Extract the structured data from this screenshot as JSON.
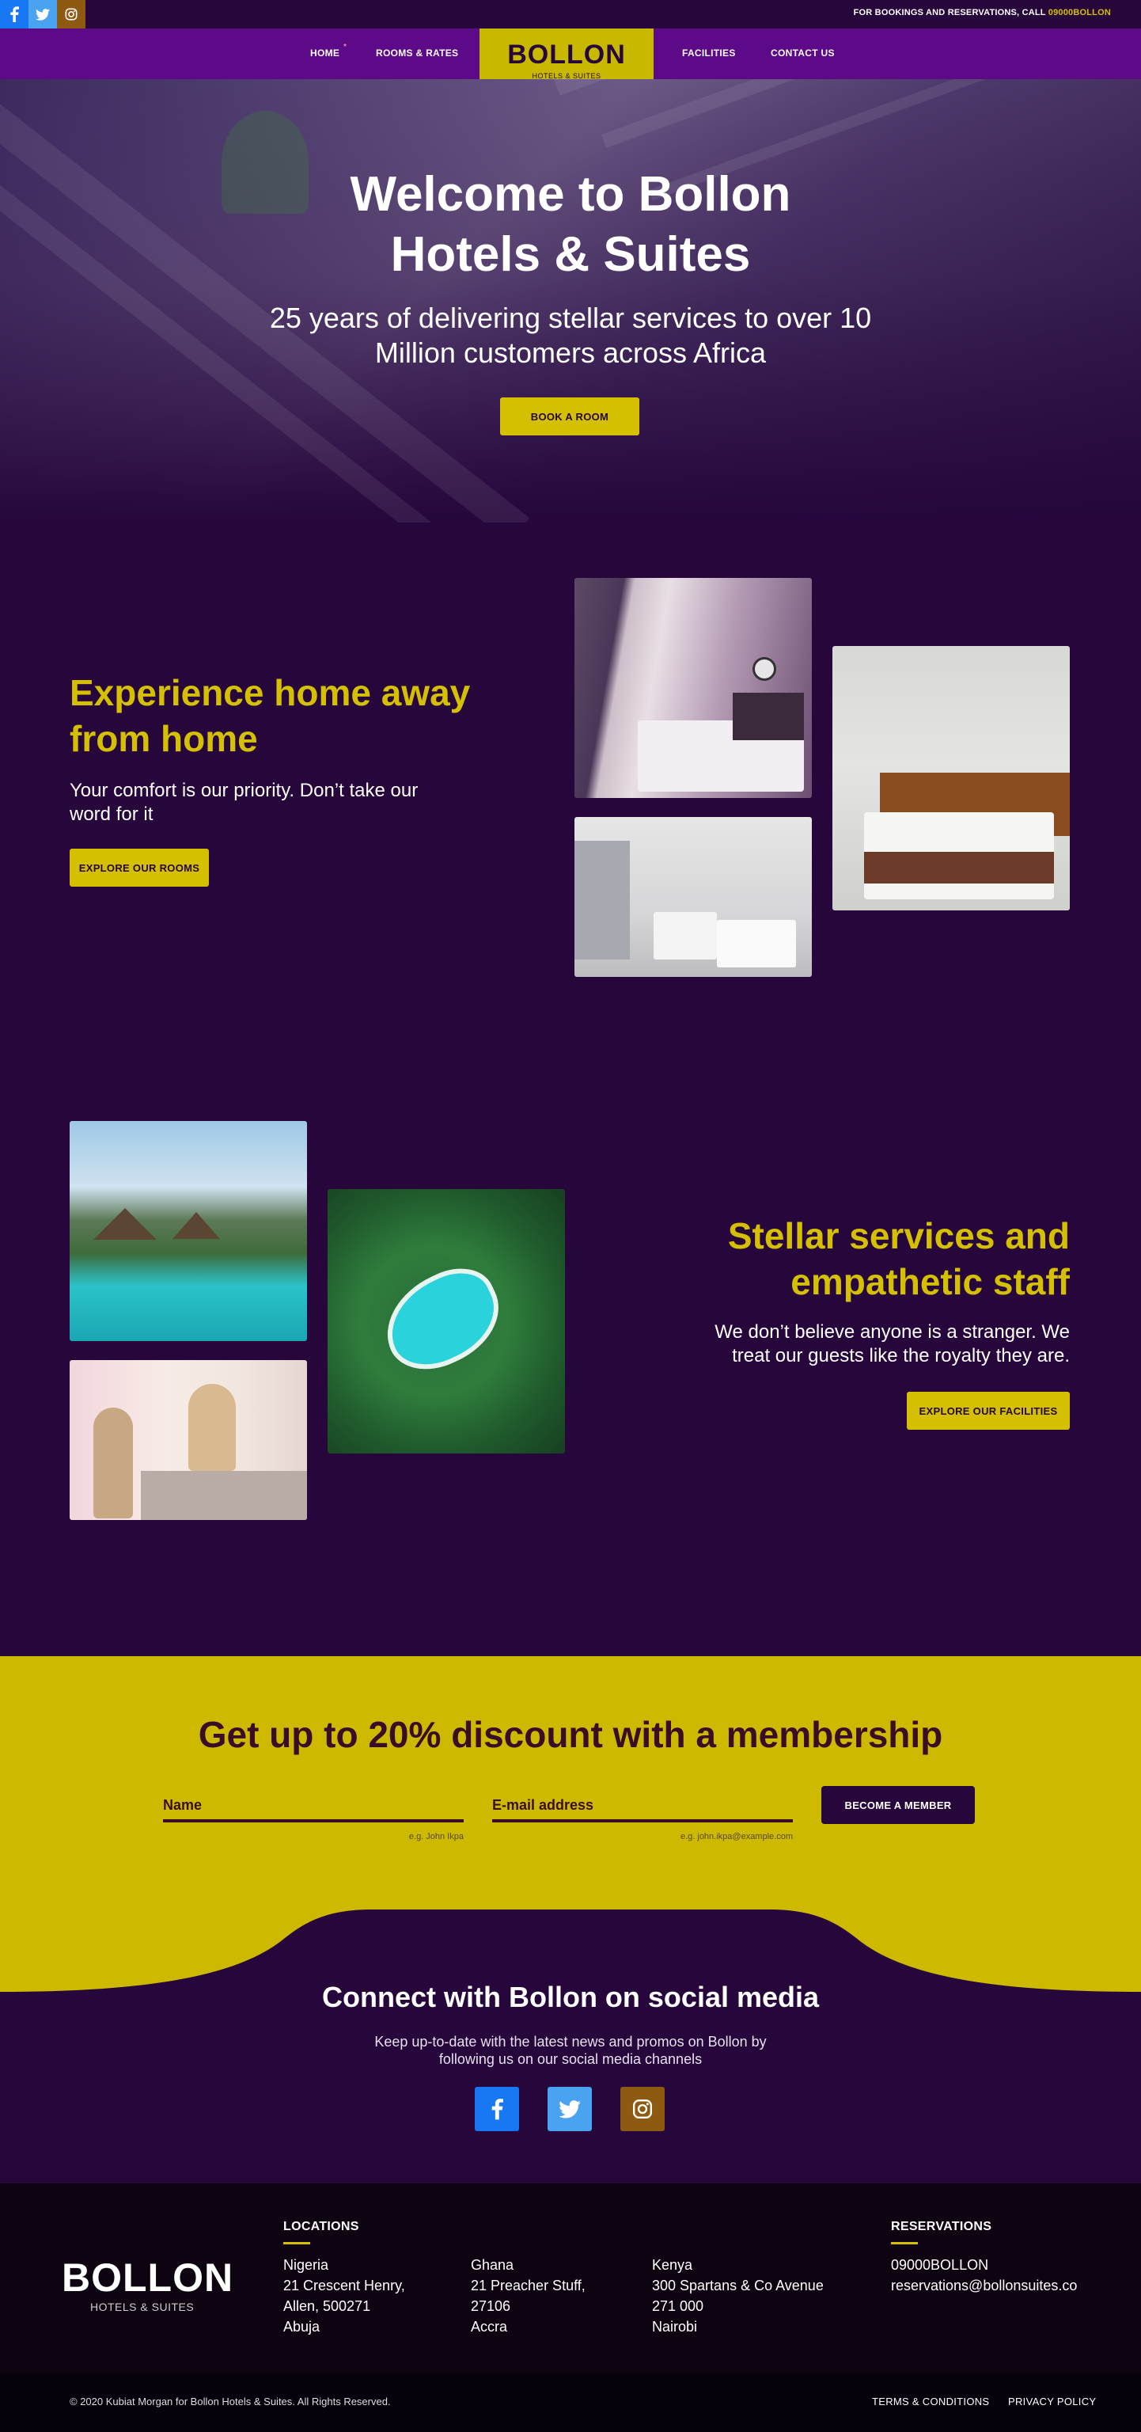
{
  "topbar": {
    "social": [
      "facebook-icon",
      "twitter-icon",
      "instagram-icon"
    ],
    "bookings_prefix": "FOR BOOKINGS AND RESERVATIONS, CALL",
    "bookings_phone": "09000BOLLON"
  },
  "nav": {
    "items": [
      {
        "label": "HOME"
      },
      {
        "label": "ROOMS & RATES"
      },
      {
        "label": "FACILITIES"
      },
      {
        "label": "CONTACT US"
      }
    ],
    "active_marker": "*",
    "logo": {
      "brand": "BOLLON",
      "sub": "HOTELS & SUITES"
    }
  },
  "hero": {
    "title_line1": "Welcome to Bollon",
    "title_line2": "Hotels & Suites",
    "subtitle_line1": "25 years of delivering stellar services to over 10",
    "subtitle_line2": "Million customers across Africa",
    "cta": "BOOK A ROOM"
  },
  "home_section": {
    "title_line1": "Experience home away",
    "title_line2": "from home",
    "body_line1": "Your comfort is our priority. Don’t take our",
    "body_line2": "word for it",
    "cta": "EXPLORE OUR ROOMS"
  },
  "staff_section": {
    "title_line1": "Stellar services and",
    "title_line2": "empathetic staff",
    "body_line1": "We don’t believe anyone is a stranger. We",
    "body_line2": "treat our guests like the royalty they are.",
    "cta": "EXPLORE OUR FACILITIES"
  },
  "membership": {
    "title": "Get up to 20% discount with a membership",
    "name_label": "Name",
    "name_hint": "e.g. John Ikpa",
    "email_label": "E-mail address",
    "email_hint": "e.g. john.ikpa@example.com",
    "button": "BECOME A MEMBER"
  },
  "social": {
    "title": "Connect with Bollon on social media",
    "body_line1": "Keep up-to-date with the latest news and promos on Bollon by",
    "body_line2": "following us on our social media channels"
  },
  "footer": {
    "brand": "BOLLON",
    "sub": "HOTELS & SUITES",
    "locations_heading": "LOCATIONS",
    "locations": [
      {
        "country": "Nigeria",
        "lines": [
          "21 Crescent Henry,",
          "Allen, 500271",
          "Abuja"
        ]
      },
      {
        "country": "Ghana",
        "lines": [
          "21 Preacher Stuff,",
          "27106",
          "Accra"
        ]
      },
      {
        "country": "Kenya",
        "lines": [
          "300 Spartans & Co Avenue",
          "271 000",
          "Nairobi"
        ]
      }
    ],
    "reservations_heading": "RESERVATIONS",
    "reservations_phone": "09000BOLLON",
    "reservations_email": "reservations@bollonsuites.co",
    "copyright": "© 2020 Kubiat Morgan for Bollon Hotels & Suites. All Rights Reserved.",
    "terms": "TERMS & CONDITIONS",
    "privacy": "PRIVACY POLICY"
  },
  "colors": {
    "background": "#26063b",
    "nav": "#5c0a87",
    "accent": "#d4c000",
    "facebook": "#1877f2",
    "twitter": "#4aa3f0",
    "instagram": "#8e5a12"
  }
}
